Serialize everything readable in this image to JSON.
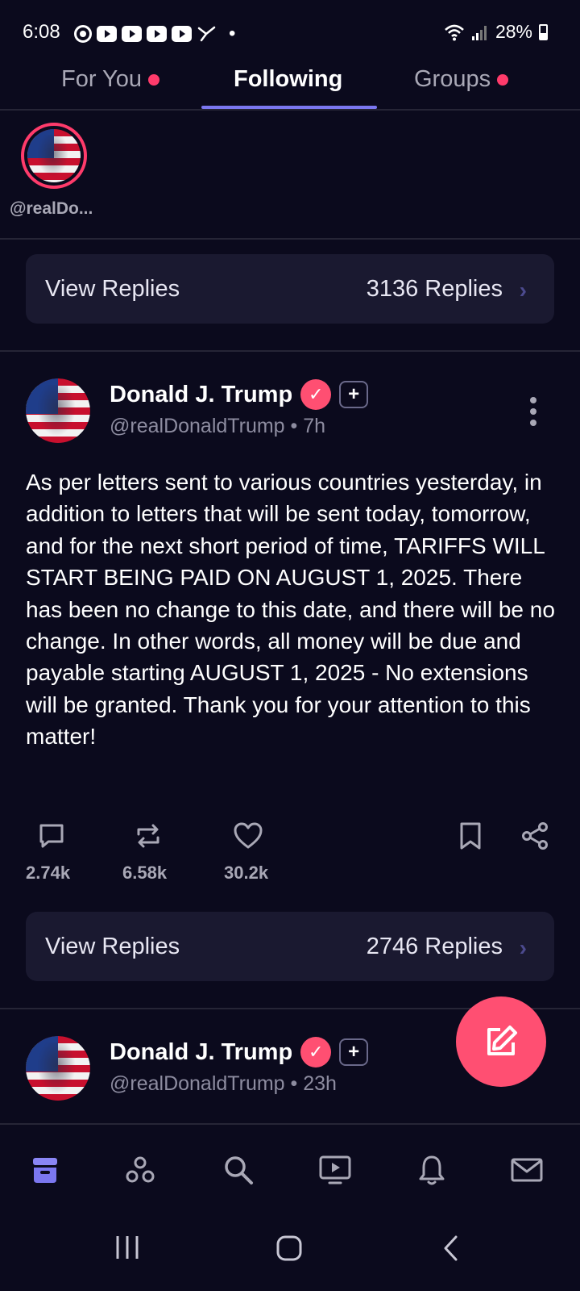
{
  "status_bar": {
    "time": "6:08",
    "battery": "28%",
    "dot": "•"
  },
  "tabs": [
    {
      "label": "For You",
      "active": false,
      "has_dot": true
    },
    {
      "label": "Following",
      "active": true,
      "has_dot": false
    },
    {
      "label": "Groups",
      "active": false,
      "has_dot": true
    }
  ],
  "story": {
    "label": "@realDo..."
  },
  "replies_cards": [
    {
      "label": "View Replies",
      "count": "3136 Replies"
    },
    {
      "label": "View Replies",
      "count": "2746 Replies"
    }
  ],
  "posts": [
    {
      "author": "Donald J. Trump",
      "plus": "+",
      "handle_line": "@realDonaldTrump • 7h",
      "body": "As per letters sent to various countries yesterday, in addition to letters that will be sent today, tomorrow, and for the next short period of time, TARIFFS WILL START BEING PAID ON AUGUST 1, 2025. There has been no change to this date, and there will be no change. In other words, all money will be due and payable starting AUGUST 1, 2025 - No extensions will be granted. Thank you for your attention to this matter!",
      "replies": "2.74k",
      "retruths": "6.58k",
      "likes": "30.2k"
    },
    {
      "author": "Donald J. Trump",
      "plus": "+",
      "handle_line": "@realDonaldTrump • 23h"
    }
  ],
  "colors": {
    "background": "#0b0a1d",
    "accent": "#7b77f0",
    "brand_pink": "#ff4f72",
    "card": "#1a1930"
  },
  "icons": {
    "bottom_nav": [
      "home-icon",
      "groups-icon",
      "search-icon",
      "video-icon",
      "bell-icon",
      "mail-icon"
    ],
    "post_actions": [
      "reply-icon",
      "retruth-icon",
      "like-icon",
      "bookmark-icon",
      "share-icon"
    ],
    "fab": "compose-icon"
  }
}
